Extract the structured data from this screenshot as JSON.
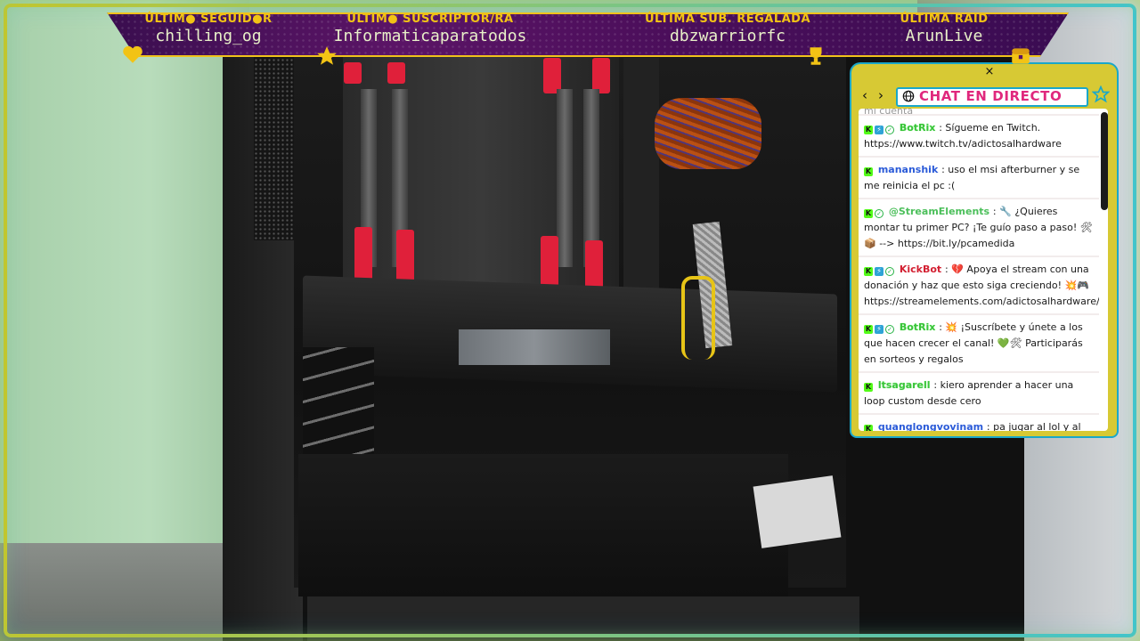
{
  "banner": {
    "items": [
      {
        "label": "ÚLTIM● SEGUID●R",
        "value": "chilling_og"
      },
      {
        "label": "ÚLTIM● SUSCRIPTOR/RA",
        "value": "Informaticaparatodos"
      },
      {
        "label": "ÚLTIMA SUB. REGALADA",
        "value": "dbzwarriorfc"
      },
      {
        "label": "ÚLTIMA RAID",
        "value": "ArunLive"
      }
    ]
  },
  "chat": {
    "title": "CHAT EN DIRECTO",
    "close_symbol": "×",
    "prev_symbol": "‹",
    "next_symbol": "›",
    "clipped_top": "mi cuenta",
    "messages": [
      {
        "user": "BotRix",
        "user_color": "green",
        "badges": [
          "k",
          "m",
          "v"
        ],
        "text": ": Sígueme en Twitch. https://www.twitch.tv/adictosalhardware"
      },
      {
        "user": "mananshik",
        "user_color": "blue",
        "badges": [
          "k"
        ],
        "text": ": uso el msi afterburner y se me reinicia el pc :("
      },
      {
        "user": "@StreamElements",
        "user_color": "lgreen",
        "badges": [
          "k",
          "v"
        ],
        "text": ": 🔧 ¿Quieres montar tu primer PC? ¡Te guío paso a paso! 🛠📦 --> https://bit.ly/pcamedida"
      },
      {
        "user": "KickBot",
        "user_color": "red",
        "badges": [
          "k",
          "m",
          "v"
        ],
        "text": ": 💔 Apoya el stream con una donación y haz que esto siga creciendo! 💥🎮 https://streamelements.com/adictosalhardware/tip"
      },
      {
        "user": "BotRix",
        "user_color": "green",
        "badges": [
          "k",
          "m",
          "v"
        ],
        "text": ": 💥 ¡Suscríbete y únete a los que hacen crecer el canal! 💚🛠 Participarás en sorteos y regalos"
      },
      {
        "user": "ltsagarell",
        "user_color": "green",
        "badges": [
          "k"
        ],
        "text": ": kiero aprender a hacer una loop custom desde cero"
      },
      {
        "user": "quanglongvovinam",
        "user_color": "blue",
        "badges": [
          "k"
        ],
        "text": ": pa jugar al lol y al csgo cual grafica va bien sin gastar muxo"
      }
    ]
  },
  "colors": {
    "banner_label": "#f2c315",
    "banner_bg": "#4a0e5a",
    "chat_frame": "#d7c934",
    "chat_accent": "#1aa7c9",
    "chat_title": "#e0287d",
    "kick_green": "#53fc18"
  },
  "icons": [
    "heart-icon",
    "star-icon",
    "trophy-icon",
    "treasure-icon",
    "globe-icon",
    "star-outline-icon",
    "close-icon",
    "chevron-left-icon",
    "chevron-right-icon"
  ]
}
